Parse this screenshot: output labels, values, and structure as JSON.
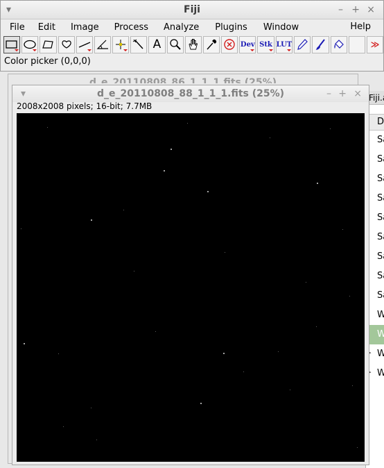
{
  "fiji": {
    "title": "Fiji",
    "menus": [
      "File",
      "Edit",
      "Image",
      "Process",
      "Analyze",
      "Plugins",
      "Window"
    ],
    "help_menu": "Help",
    "status": "Color picker (0,0,0)",
    "tools": [
      {
        "name": "rectangle-tool",
        "icon": "rectangle-selection-icon"
      },
      {
        "name": "oval-tool",
        "icon": "oval-selection-icon"
      },
      {
        "name": "polygon-tool",
        "icon": "polygon-selection-icon"
      },
      {
        "name": "freehand-tool",
        "icon": "freehand-selection-icon"
      },
      {
        "name": "line-tool",
        "icon": "straight-line-icon"
      },
      {
        "name": "angle-tool",
        "icon": "angle-icon"
      },
      {
        "name": "point-tool",
        "icon": "multipoint-icon"
      },
      {
        "name": "wand-tool",
        "icon": "wand-icon"
      },
      {
        "name": "text-tool",
        "icon": "text-icon",
        "label": "A"
      },
      {
        "name": "magnifier-tool",
        "icon": "magnifier-icon"
      },
      {
        "name": "scroll-tool",
        "icon": "hand-icon"
      },
      {
        "name": "color-picker-tool",
        "icon": "dropper-icon"
      },
      {
        "name": "stop-tool",
        "icon": "stop-icon"
      },
      {
        "name": "dev-tool",
        "icon": "dev-menu-icon",
        "label": "Dev"
      },
      {
        "name": "stk-tool",
        "icon": "stack-menu-icon",
        "label": "Stk"
      },
      {
        "name": "lut-tool",
        "icon": "lut-menu-icon",
        "label": "LUT"
      },
      {
        "name": "pencil-tool",
        "icon": "pencil-icon"
      },
      {
        "name": "brush-tool",
        "icon": "paintbrush-icon"
      },
      {
        "name": "flood-fill-tool",
        "icon": "flood-fill-icon"
      },
      {
        "name": "blank-tool",
        "icon": ""
      },
      {
        "name": "more-tools",
        "icon": "more-tools-icon",
        "label": "≫"
      }
    ]
  },
  "back_image_window": {
    "title": "d_e_20110808_86_1_1_1.fits (25%)"
  },
  "image_window": {
    "title": "d_e_20110808_88_1_1_1.fits (25%)",
    "info": "2008x2008 pixels; 16-bit; 7.7MB"
  },
  "side_window": {
    "header": "Fiji.a",
    "column_header": "D",
    "rows": [
      {
        "text": "Sa",
        "selected": false,
        "bullet": false
      },
      {
        "text": "Sa",
        "selected": false,
        "bullet": false
      },
      {
        "text": "Sa",
        "selected": false,
        "bullet": false
      },
      {
        "text": "Sa",
        "selected": false,
        "bullet": false
      },
      {
        "text": "Sa",
        "selected": false,
        "bullet": false
      },
      {
        "text": "Sa",
        "selected": false,
        "bullet": false
      },
      {
        "text": "Sa",
        "selected": false,
        "bullet": false
      },
      {
        "text": "Sa",
        "selected": false,
        "bullet": false
      },
      {
        "text": "Sa",
        "selected": false,
        "bullet": false
      },
      {
        "text": "W",
        "selected": false,
        "bullet": false
      },
      {
        "text": "W",
        "selected": true,
        "bullet": false
      },
      {
        "text": "W",
        "selected": false,
        "bullet": true
      },
      {
        "text": "W",
        "selected": false,
        "bullet": true
      }
    ]
  },
  "colors": {
    "image_background": "#000000",
    "selected_row": "#a3c79a",
    "tool_caret": "#d31d1d"
  }
}
